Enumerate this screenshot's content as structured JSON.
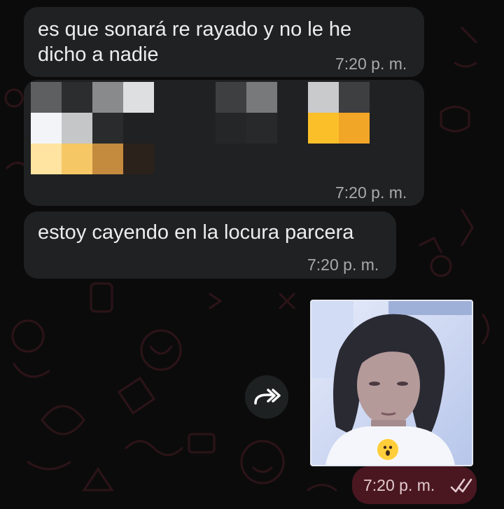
{
  "messages": [
    {
      "direction": "incoming",
      "text": "es que sonará re rayado y no le he",
      "text_line2": "dicho a nadie",
      "time": "7:20 p. m."
    },
    {
      "direction": "incoming",
      "type": "image-pixelated",
      "time": "7:20 p. m."
    },
    {
      "direction": "incoming",
      "text": "estoy cayendo en la locura parcera",
      "time": "7:20 p. m."
    },
    {
      "direction": "outgoing",
      "type": "photo",
      "reaction_icon": "astonished-face-icon",
      "time": "7:20 p. m.",
      "status_icon": "double-check-icon"
    }
  ],
  "colors": {
    "incoming_bubble": "#1f2122",
    "outgoing_time_bubble": "#4a1721",
    "wallpaper": "#0c0b0c",
    "time_text": "#a7aaab"
  },
  "icons": {
    "forward": "forward-icon",
    "read_receipt": "double-check-icon"
  }
}
